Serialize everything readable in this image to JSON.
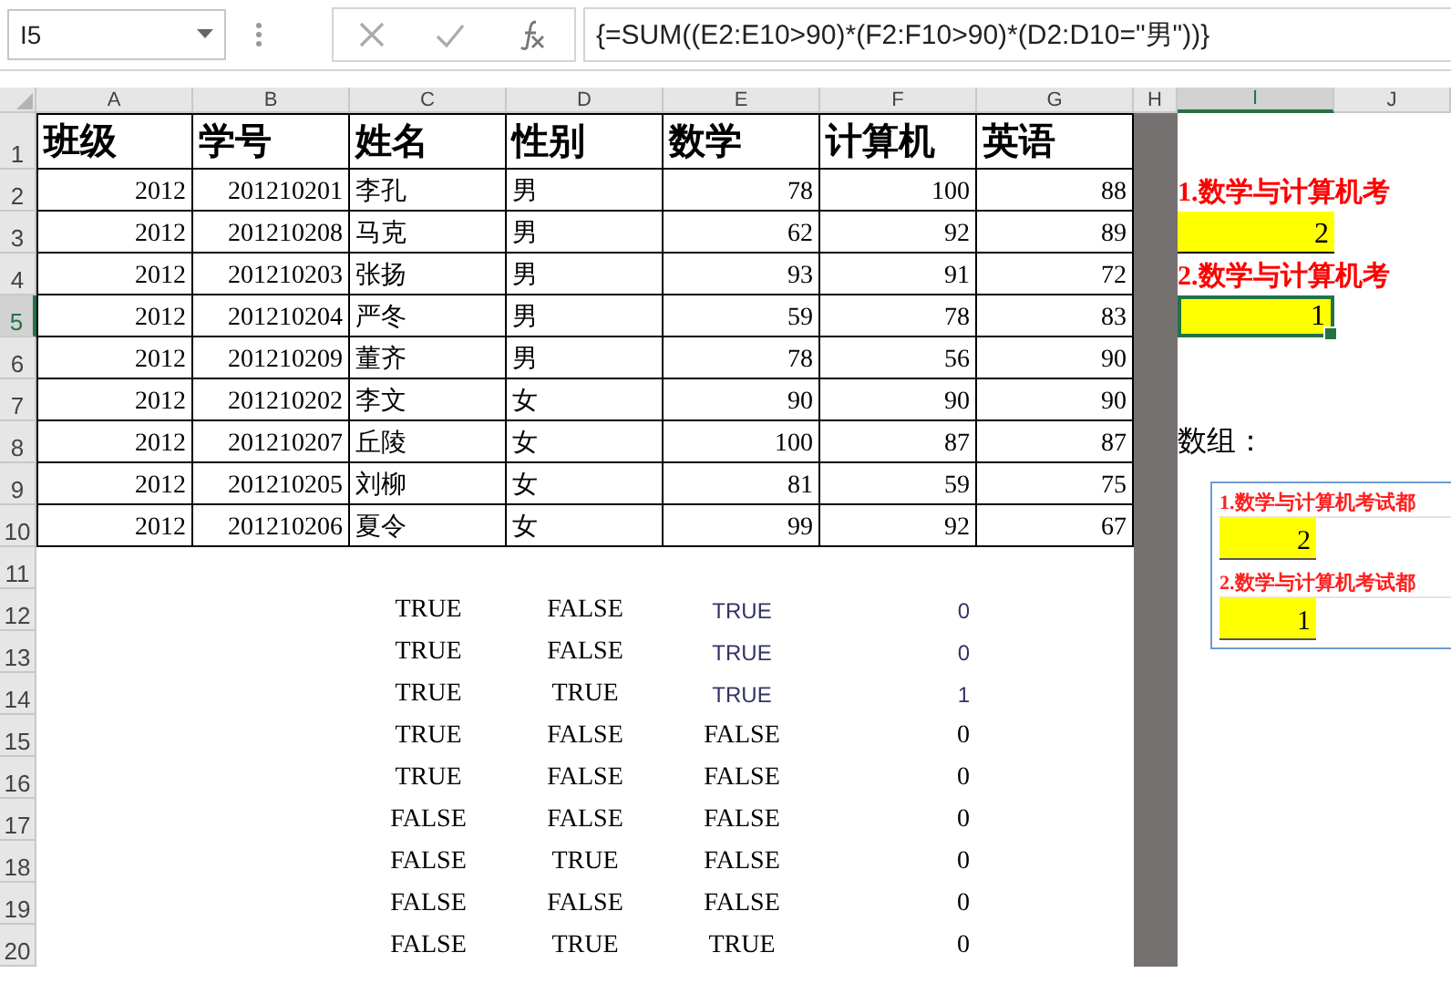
{
  "name_box": "I5",
  "formula": "{=SUM((E2:E10>90)*(F2:F10>90)*(D2:D10=\"男\"))}",
  "columns": [
    {
      "label": "A",
      "selected": false
    },
    {
      "label": "B",
      "selected": false
    },
    {
      "label": "C",
      "selected": false
    },
    {
      "label": "D",
      "selected": false
    },
    {
      "label": "E",
      "selected": false
    },
    {
      "label": "F",
      "selected": false
    },
    {
      "label": "G",
      "selected": false
    },
    {
      "label": "H",
      "selected": false
    },
    {
      "label": "I",
      "selected": true
    },
    {
      "label": "J",
      "selected": false
    }
  ],
  "row_numbers": [
    {
      "label": "1",
      "selected": false
    },
    {
      "label": "2",
      "selected": false
    },
    {
      "label": "3",
      "selected": false
    },
    {
      "label": "4",
      "selected": false
    },
    {
      "label": "5",
      "selected": true
    },
    {
      "label": "6",
      "selected": false
    },
    {
      "label": "7",
      "selected": false
    },
    {
      "label": "8",
      "selected": false
    },
    {
      "label": "9",
      "selected": false
    },
    {
      "label": "10",
      "selected": false
    },
    {
      "label": "11",
      "selected": false
    },
    {
      "label": "12",
      "selected": false
    },
    {
      "label": "13",
      "selected": false
    },
    {
      "label": "14",
      "selected": false
    },
    {
      "label": "15",
      "selected": false
    },
    {
      "label": "16",
      "selected": false
    },
    {
      "label": "17",
      "selected": false
    },
    {
      "label": "18",
      "selected": false
    },
    {
      "label": "19",
      "selected": false
    },
    {
      "label": "20",
      "selected": false
    }
  ],
  "table_header": [
    "班级",
    "学号",
    "姓名",
    "性别",
    "数学",
    "计算机",
    "英语"
  ],
  "students": [
    [
      "2012",
      "201210201",
      "李孔",
      "男",
      "78",
      "100",
      "88"
    ],
    [
      "2012",
      "201210208",
      "马克",
      "男",
      "62",
      "92",
      "89"
    ],
    [
      "2012",
      "201210203",
      "张扬",
      "男",
      "93",
      "91",
      "72"
    ],
    [
      "2012",
      "201210204",
      "严冬",
      "男",
      "59",
      "78",
      "83"
    ],
    [
      "2012",
      "201210209",
      "董齐",
      "男",
      "78",
      "56",
      "90"
    ],
    [
      "2012",
      "201210202",
      "李文",
      "女",
      "90",
      "90",
      "90"
    ],
    [
      "2012",
      "201210207",
      "丘陵",
      "女",
      "100",
      "87",
      "87"
    ],
    [
      "2012",
      "201210205",
      "刘柳",
      "女",
      "81",
      "59",
      "75"
    ],
    [
      "2012",
      "201210206",
      "夏令",
      "女",
      "99",
      "92",
      "67"
    ]
  ],
  "checks": [
    {
      "kind": "mixed",
      "cells": [
        "TRUE",
        "FALSE",
        "TRUE",
        "0"
      ]
    },
    {
      "kind": "mixed",
      "cells": [
        "TRUE",
        "FALSE",
        "TRUE",
        "0"
      ]
    },
    {
      "kind": "mixed",
      "cells": [
        "TRUE",
        "TRUE",
        "TRUE",
        "1"
      ]
    },
    {
      "kind": "plain",
      "cells": [
        "TRUE",
        "FALSE",
        "FALSE",
        "0"
      ]
    },
    {
      "kind": "plain",
      "cells": [
        "TRUE",
        "FALSE",
        "FALSE",
        "0"
      ]
    },
    {
      "kind": "plain",
      "cells": [
        "FALSE",
        "FALSE",
        "FALSE",
        "0"
      ]
    },
    {
      "kind": "plain",
      "cells": [
        "FALSE",
        "TRUE",
        "FALSE",
        "0"
      ]
    },
    {
      "kind": "plain",
      "cells": [
        "FALSE",
        "FALSE",
        "FALSE",
        "0"
      ]
    },
    {
      "kind": "plain",
      "cells": [
        "FALSE",
        "TRUE",
        "TRUE",
        "0"
      ]
    }
  ],
  "answers": [
    {
      "question": "1.数学与计算机考",
      "value": "2",
      "selected": false
    },
    {
      "question": "2.数学与计算机考",
      "value": "1",
      "selected": true
    }
  ],
  "array_label": "数组：",
  "embedded": [
    {
      "question": "1.数学与计算机考试都",
      "value": "2"
    },
    {
      "question": "2.数学与计算机考试都",
      "value": "1"
    }
  ]
}
